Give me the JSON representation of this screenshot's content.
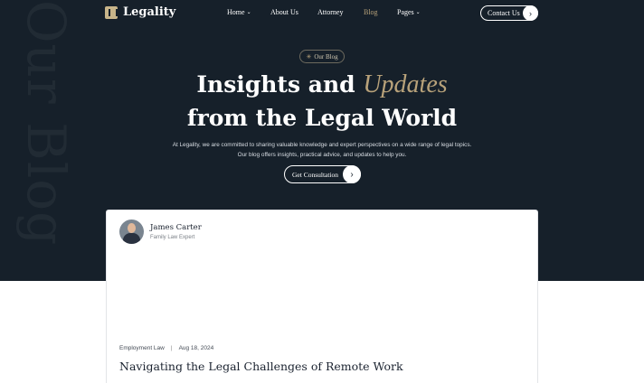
{
  "watermark": "Our Blog",
  "brand": {
    "name": "Legality"
  },
  "nav": {
    "items": [
      {
        "label": "Home",
        "has_dropdown": true,
        "active": false
      },
      {
        "label": "About Us",
        "has_dropdown": false,
        "active": false
      },
      {
        "label": "Attorney",
        "has_dropdown": false,
        "active": false
      },
      {
        "label": "Blog",
        "has_dropdown": false,
        "active": true
      },
      {
        "label": "Pages",
        "has_dropdown": true,
        "active": false
      }
    ],
    "contact_label": "Contact Us"
  },
  "hero": {
    "badge": "Our Blog",
    "headline_part1": "Insights and",
    "headline_accent": "Updates",
    "headline_line2": "from the Legal World",
    "description": "At Legality, we are committed to sharing valuable knowledge and expert perspectives on a wide range of legal topics. Our blog offers insights, practical advice, and updates to help you.",
    "cta_label": "Get Consultation"
  },
  "post": {
    "author_name": "James Carter",
    "author_role": "Family Law Expert",
    "category": "Employment Law",
    "date": "Aug 18, 2024",
    "title": "Navigating the Legal Challenges of Remote Work"
  },
  "colors": {
    "hero_bg": "#16202a",
    "accent_gold": "#b8a27a",
    "text_light": "#ffffff"
  }
}
